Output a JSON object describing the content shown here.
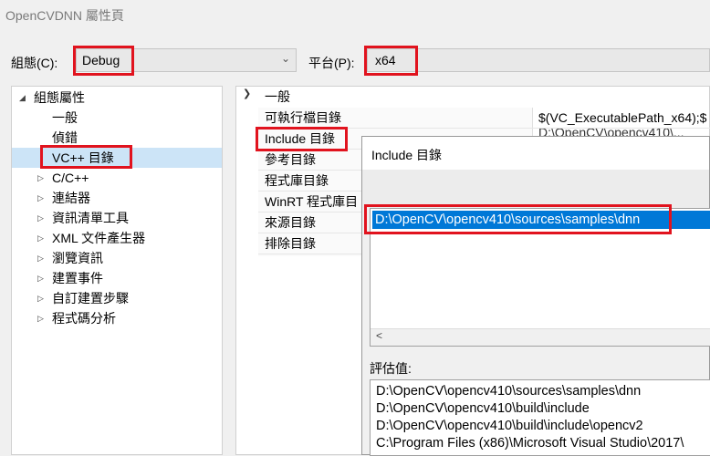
{
  "window": {
    "title": "OpenCVDNN 屬性頁"
  },
  "config": {
    "label": "組態(C):",
    "value": "Debug",
    "platform_label": "平台(P):",
    "platform_value": "x64"
  },
  "tree": {
    "root": "組態屬性",
    "items": [
      {
        "label": "一般"
      },
      {
        "label": "偵錯"
      },
      {
        "label": "VC++ 目錄"
      },
      {
        "label": "C/C++"
      },
      {
        "label": "連結器"
      },
      {
        "label": "資訊清單工具"
      },
      {
        "label": "XML 文件產生器"
      },
      {
        "label": "瀏覽資訊"
      },
      {
        "label": "建置事件"
      },
      {
        "label": "自訂建置步驟"
      },
      {
        "label": "程式碼分析"
      }
    ]
  },
  "grid": {
    "section": "一般",
    "rows": [
      {
        "name": "可執行檔目錄",
        "value": "$(VC_ExecutablePath_x64);$"
      },
      {
        "name": "Include 目錄",
        "value": "D:\\OpenCV\\opencv410\\..."
      },
      {
        "name": "參考目錄",
        "value": ""
      },
      {
        "name": "程式庫目錄",
        "value": ""
      },
      {
        "name": "WinRT 程式庫目",
        "value": ""
      },
      {
        "name": "來源目錄",
        "value": ""
      },
      {
        "name": "排除目錄",
        "value": ""
      }
    ]
  },
  "dialog": {
    "title": "Include 目錄",
    "entry": "D:\\OpenCV\\opencv410\\sources\\samples\\dnn",
    "scroll_left": "<",
    "eval_label": "評估值:",
    "eval_lines": [
      "D:\\OpenCV\\opencv410\\sources\\samples\\dnn",
      "D:\\OpenCV\\opencv410\\build\\include",
      "D:\\OpenCV\\opencv410\\build\\include\\opencv2",
      "C:\\Program Files (x86)\\Microsoft Visual Studio\\2017\\"
    ]
  }
}
